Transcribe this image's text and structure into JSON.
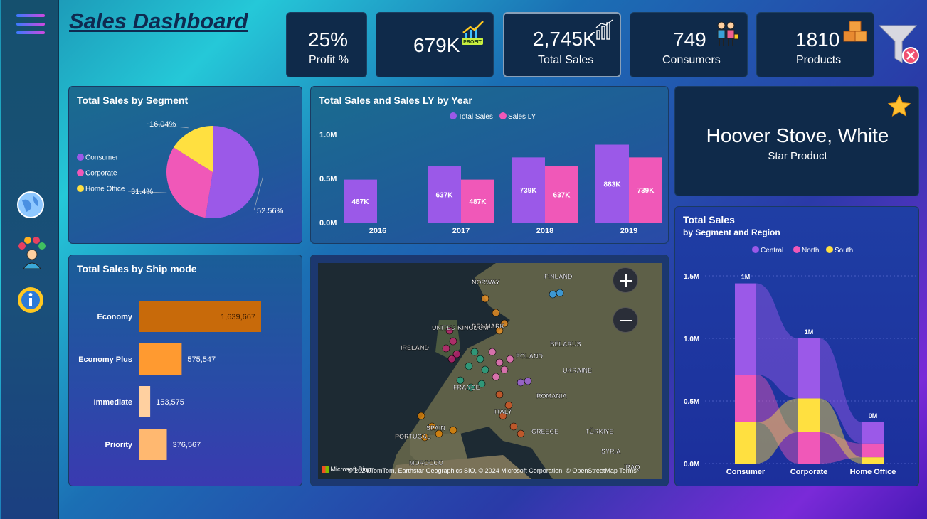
{
  "header": {
    "title": "Sales Dashboard"
  },
  "kpis": [
    {
      "value": "25%",
      "label": "Profit %"
    },
    {
      "value": "679K",
      "label": "",
      "badge": "PROFIT"
    },
    {
      "value": "2,745K",
      "label": "Total Sales"
    },
    {
      "value": "749",
      "label": "Consumers"
    },
    {
      "value": "1810",
      "label": "Products"
    }
  ],
  "star_product": {
    "name": "Hoover Stove, White",
    "label": "Star Product"
  },
  "colors": {
    "purple": "#9b59e8",
    "pink": "#f058b8",
    "yellow": "#ffe040",
    "orange_dark": "#c86a0a",
    "orange": "#ffa030",
    "orange_light": "#ffd8a0"
  },
  "map": {
    "labels": [
      "FINLAND",
      "NORWAY",
      "DENMARK",
      "UNITED KINGDOM",
      "IRELAND",
      "BELARUS",
      "POLAND",
      "UKRAINE",
      "FRANCE",
      "ROMANIA",
      "ITALY",
      "SPAIN",
      "PORTUGAL",
      "GREECE",
      "TÜRKIYE",
      "SYRIA",
      "IRAQ",
      "MOROCCO"
    ],
    "credits": "© 2024 TomTom, Earthstar Geographics SIO, © 2024 Microsoft Corporation, © OpenStreetMap  Terms",
    "brand": "Microsoft Bing"
  },
  "chart_data": [
    {
      "type": "pie",
      "title": "Total Sales by Segment",
      "categories": [
        "Consumer",
        "Corporate",
        "Home Office"
      ],
      "values": [
        52.56,
        31.4,
        16.04
      ],
      "labels": [
        "52.56%",
        "31.4%",
        "16.04%"
      ],
      "colors": [
        "#9b59e8",
        "#f058b8",
        "#ffe040"
      ],
      "legend": "left"
    },
    {
      "type": "bar",
      "title": "Total Sales and Sales LY by Year",
      "categories": [
        "2016",
        "2017",
        "2018",
        "2019"
      ],
      "series": [
        {
          "name": "Total Sales",
          "values": [
            487,
            637,
            739,
            883
          ],
          "labels": [
            "487K",
            "637K",
            "739K",
            "883K"
          ],
          "color": "#9b59e8"
        },
        {
          "name": "Sales LY",
          "values": [
            null,
            487,
            637,
            739
          ],
          "labels": [
            "",
            "487K",
            "637K",
            "739K"
          ],
          "color": "#f058b8"
        }
      ],
      "yticks": [
        "0.0M",
        "0.5M",
        "1.0M"
      ],
      "ylim": [
        0,
        1000
      ],
      "legend": "top"
    },
    {
      "type": "bar",
      "orientation": "horizontal",
      "title": "Total Sales by Ship mode",
      "categories": [
        "Economy",
        "Economy Plus",
        "Immediate",
        "Priority"
      ],
      "values": [
        1639667,
        575547,
        153575,
        376567
      ],
      "labels": [
        "1,639,667",
        "575,547",
        "153,575",
        "376,567"
      ],
      "colors": [
        "#c86a0a",
        "#ff9a30",
        "#ffd0a0",
        "#ffb870"
      ]
    },
    {
      "type": "bar",
      "subtype": "ribbon",
      "title": "Total Sales",
      "subtitle": "by Segment and Region",
      "categories": [
        "Consumer",
        "Corporate",
        "Home Office"
      ],
      "series": [
        {
          "name": "Central",
          "values": [
            0.73,
            0.48,
            0.17
          ],
          "color": "#9b59e8"
        },
        {
          "name": "North",
          "values": [
            0.38,
            0.25,
            0.11
          ],
          "color": "#f058b8"
        },
        {
          "name": "South",
          "values": [
            0.33,
            0.27,
            0.05
          ],
          "color": "#ffe040"
        }
      ],
      "totals": [
        "1M",
        "1M",
        "0M"
      ],
      "yticks": [
        "0.0M",
        "0.5M",
        "1.0M",
        "1.5M"
      ],
      "ylim": [
        0,
        1.5
      ],
      "legend": "top"
    }
  ]
}
